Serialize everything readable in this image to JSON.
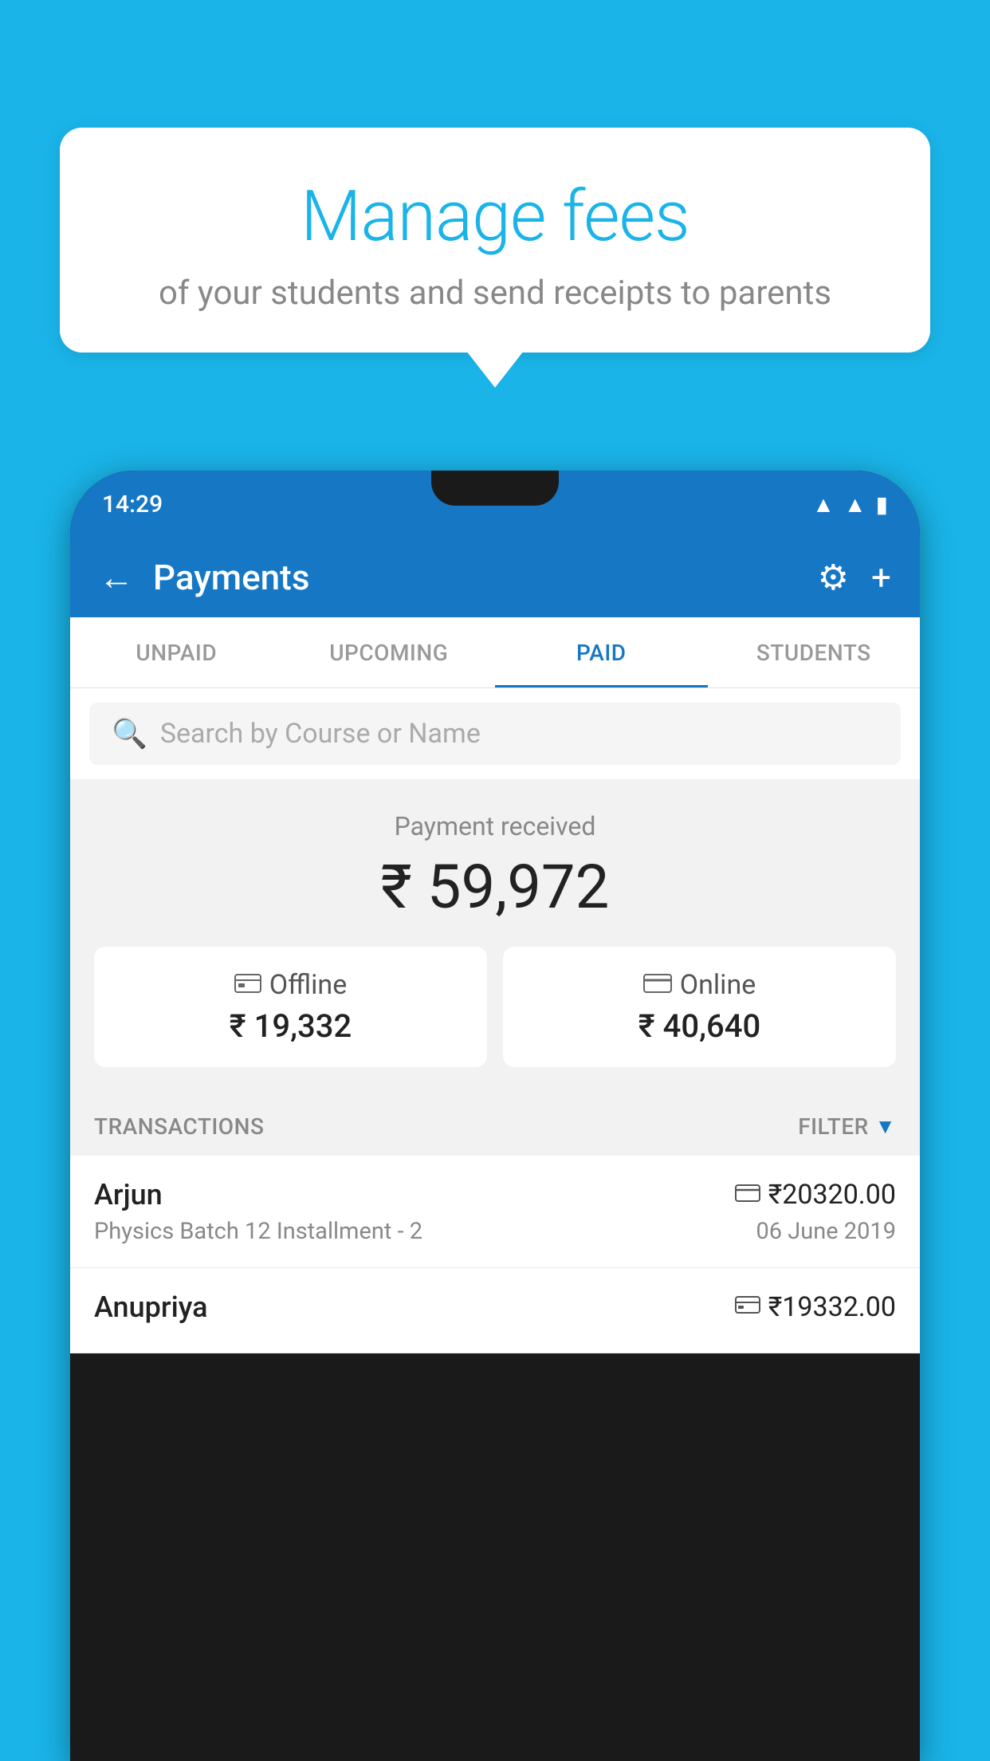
{
  "background": {
    "color": "#1ab4e8"
  },
  "speech_bubble": {
    "title": "Manage fees",
    "subtitle": "of your students and send receipts to parents"
  },
  "phone": {
    "status_bar": {
      "time": "14:29"
    },
    "header": {
      "title": "Payments",
      "back_label": "←",
      "gear_label": "⚙",
      "plus_label": "+"
    },
    "tabs": [
      {
        "label": "UNPAID",
        "active": false
      },
      {
        "label": "UPCOMING",
        "active": false
      },
      {
        "label": "PAID",
        "active": true
      },
      {
        "label": "STUDENTS",
        "active": false
      }
    ],
    "search": {
      "placeholder": "Search by Course or Name"
    },
    "payment_received": {
      "label": "Payment received",
      "amount": "₹ 59,972",
      "offline": {
        "label": "Offline",
        "amount": "₹ 19,332"
      },
      "online": {
        "label": "Online",
        "amount": "₹ 40,640"
      }
    },
    "transactions": {
      "header_label": "TRANSACTIONS",
      "filter_label": "FILTER",
      "rows": [
        {
          "name": "Arjun",
          "amount": "₹20320.00",
          "course": "Physics Batch 12 Installment - 2",
          "date": "06 June 2019",
          "type": "online"
        },
        {
          "name": "Anupriya",
          "amount": "₹19332.00",
          "course": "",
          "date": "",
          "type": "offline"
        }
      ]
    }
  }
}
